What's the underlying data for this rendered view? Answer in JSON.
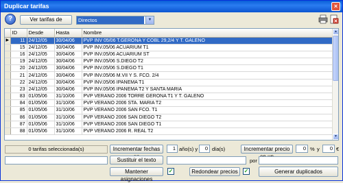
{
  "window": {
    "title": "Duplicar tarifas",
    "close_glyph": "×"
  },
  "toolbar": {
    "help_glyph": "?",
    "ver_tarifas_label": "Ver tarifas de",
    "filter_selected": "Directos",
    "icons": [
      "help-icon",
      "print-icon",
      "export-icon"
    ]
  },
  "grid": {
    "columns": [
      "ID",
      "Desde",
      "Hasta",
      "Nombre"
    ],
    "rows": [
      {
        "id": "11",
        "desde": "24/12/05",
        "hasta": "30/04/06",
        "nombre": "PVP   INV 05/06 T.GERONA  Y COBL 29,2/4 Y T. GALENO",
        "selected": true
      },
      {
        "id": "15",
        "desde": "24/12/05",
        "hasta": "30/04/06",
        "nombre": "PVP   INV.05/06 ACUARIUM T1"
      },
      {
        "id": "16",
        "desde": "24/12/05",
        "hasta": "30/04/06",
        "nombre": "PVP   INV.05/06 ACUARIUM ST"
      },
      {
        "id": "19",
        "desde": "24/12/05",
        "hasta": "30/04/06",
        "nombre": "PVP   INV.05/06 S.DIEGO T2"
      },
      {
        "id": "20",
        "desde": "24/12/05",
        "hasta": "30/04/06",
        "nombre": "PVP   INV.05/06 S.DIEGO T1"
      },
      {
        "id": "21",
        "desde": "24/12/05",
        "hasta": "30/04/06",
        "nombre": "PVP   INV.05/06 M.VII Y S. FCO. 2/4"
      },
      {
        "id": "22",
        "desde": "24/12/05",
        "hasta": "30/04/06",
        "nombre": "PVP   INV.05/06 IPANEMA  T1"
      },
      {
        "id": "23",
        "desde": "24/12/05",
        "hasta": "30/04/06",
        "nombre": "PVP   INV.05/06 IPANEMA  T2 Y SANTA MARIA"
      },
      {
        "id": "83",
        "desde": "01/05/06",
        "hasta": "31/10/06",
        "nombre": "PVP   VERANO 2006 TORRE GERONA  T1 Y T. GALENO"
      },
      {
        "id": "84",
        "desde": "01/05/06",
        "hasta": "31/10/06",
        "nombre": "PVP   VERANO 2006 STA. MARIA  T2"
      },
      {
        "id": "85",
        "desde": "01/05/06",
        "hasta": "31/10/06",
        "nombre": "PVP   VERANO 2006 SAN FCO. T1"
      },
      {
        "id": "86",
        "desde": "01/05/06",
        "hasta": "31/10/06",
        "nombre": "PVP   VERANO 2006 SAN DIEGO  T2"
      },
      {
        "id": "87",
        "desde": "01/05/06",
        "hasta": "31/10/06",
        "nombre": "PVP   VERANO 2006 SAN DIEGO  T1"
      },
      {
        "id": "88",
        "desde": "01/05/06",
        "hasta": "31/10/06",
        "nombre": "PVP   VERANO 2006 R. REAL  T2"
      }
    ]
  },
  "footer": {
    "selected_count": "0 tarifas seleccionada(s)",
    "incrementar_fechas_label": "Incrementar fechas en",
    "anios_value": "1",
    "anios_label": "año(s) y",
    "dias_value": "0",
    "dias_label": "día(s)",
    "incrementar_precio_label": "Incrementar precio en un",
    "pct_value": "0",
    "pct_label": "%",
    "y_label": "y",
    "euro_value": "0",
    "euro_label": "€",
    "sustituir_label": "Sustituir el texto",
    "sustituir_value": "",
    "por_label": "por",
    "por_value": "",
    "mantener_label": "Mantener asignaciones",
    "mantener_checked": "✓",
    "redondear_label": "Redondear precios",
    "redondear_checked": "✓",
    "generar_label": "Generar duplicados",
    "left_field_value": ""
  }
}
